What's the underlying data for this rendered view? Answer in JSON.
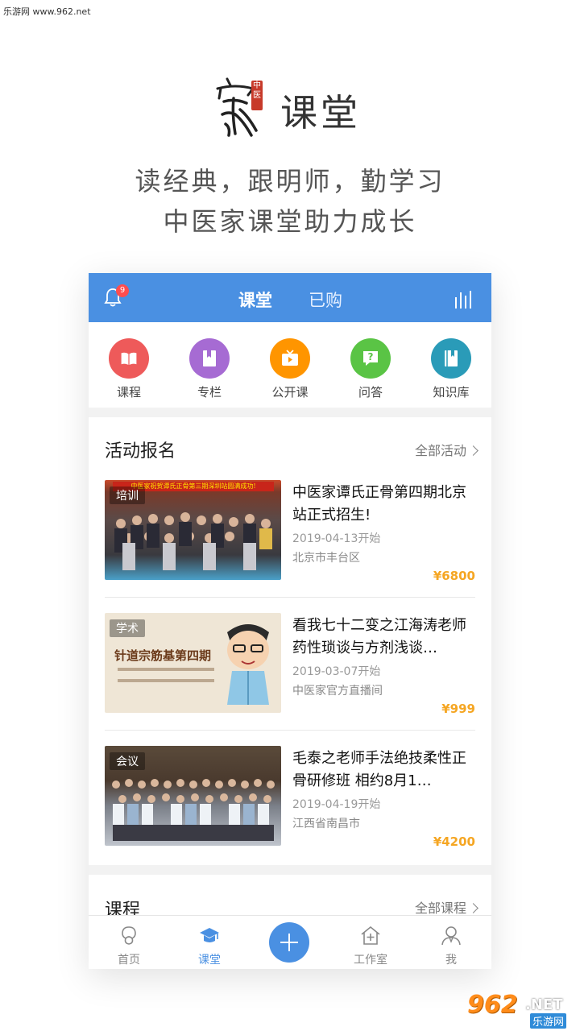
{
  "watermark_top": "乐游网 www.962.net",
  "hero": {
    "app_word": "课堂",
    "logo_seal_text": "中医",
    "slogan_line1": "读经典，跟明师，勤学习",
    "slogan_line2": "中医家课堂助力成长"
  },
  "topbar": {
    "badge_count": "9",
    "tab_active": "课堂",
    "tab_inactive": "已购",
    "color": "#4a90e2"
  },
  "quicknav": [
    {
      "label": "课程",
      "icon": "book-icon",
      "color": "#ee5a5a"
    },
    {
      "label": "专栏",
      "icon": "bookmark-book-icon",
      "color": "#a66bd3"
    },
    {
      "label": "公开课",
      "icon": "tv-icon",
      "color": "#ff9500"
    },
    {
      "label": "问答",
      "icon": "question-chat-icon",
      "color": "#5ac445"
    },
    {
      "label": "知识库",
      "icon": "library-book-icon",
      "color": "#2a9bb8"
    }
  ],
  "activities": {
    "title": "活动报名",
    "more": "全部活动",
    "items": [
      {
        "tag": "培训",
        "title": "中医家谭氏正骨第四期北京站正式招生!",
        "date": "2019-04-13开始",
        "location": "北京市丰台区",
        "price": "¥6800",
        "banner_text": "中医家祝贺谭氏正骨第三期深圳站圆满成功!"
      },
      {
        "tag": "学术",
        "title": "看我七十二变之江海涛老师药性琐谈与方剂浅谈…",
        "date": "2019-03-07开始",
        "location": "中医家官方直播间",
        "price": "¥999",
        "poster_title": "针道宗筋基第四期"
      },
      {
        "tag": "会议",
        "title": "毛泰之老师手法绝技柔性正骨研修班 相约8月1…",
        "date": "2019-04-19开始",
        "location": "江西省南昌市",
        "price": "¥4200"
      }
    ]
  },
  "courses": {
    "title": "课程",
    "more": "全部课程"
  },
  "bottomnav": [
    {
      "label": "首页",
      "icon": "home-leaf-icon",
      "active": false
    },
    {
      "label": "课堂",
      "icon": "graduation-cap-icon",
      "active": true
    },
    {
      "label": "",
      "icon": "plus-icon",
      "active": false
    },
    {
      "label": "工作室",
      "icon": "house-plus-icon",
      "active": false
    },
    {
      "label": "我",
      "icon": "user-icon",
      "active": false
    }
  ],
  "watermark_br": {
    "logo": "962",
    "net": ".NET",
    "cn": "乐游网"
  },
  "colors": {
    "accent": "#4a90e2",
    "price": "#f5a623",
    "badge": "#ff4d4f"
  }
}
